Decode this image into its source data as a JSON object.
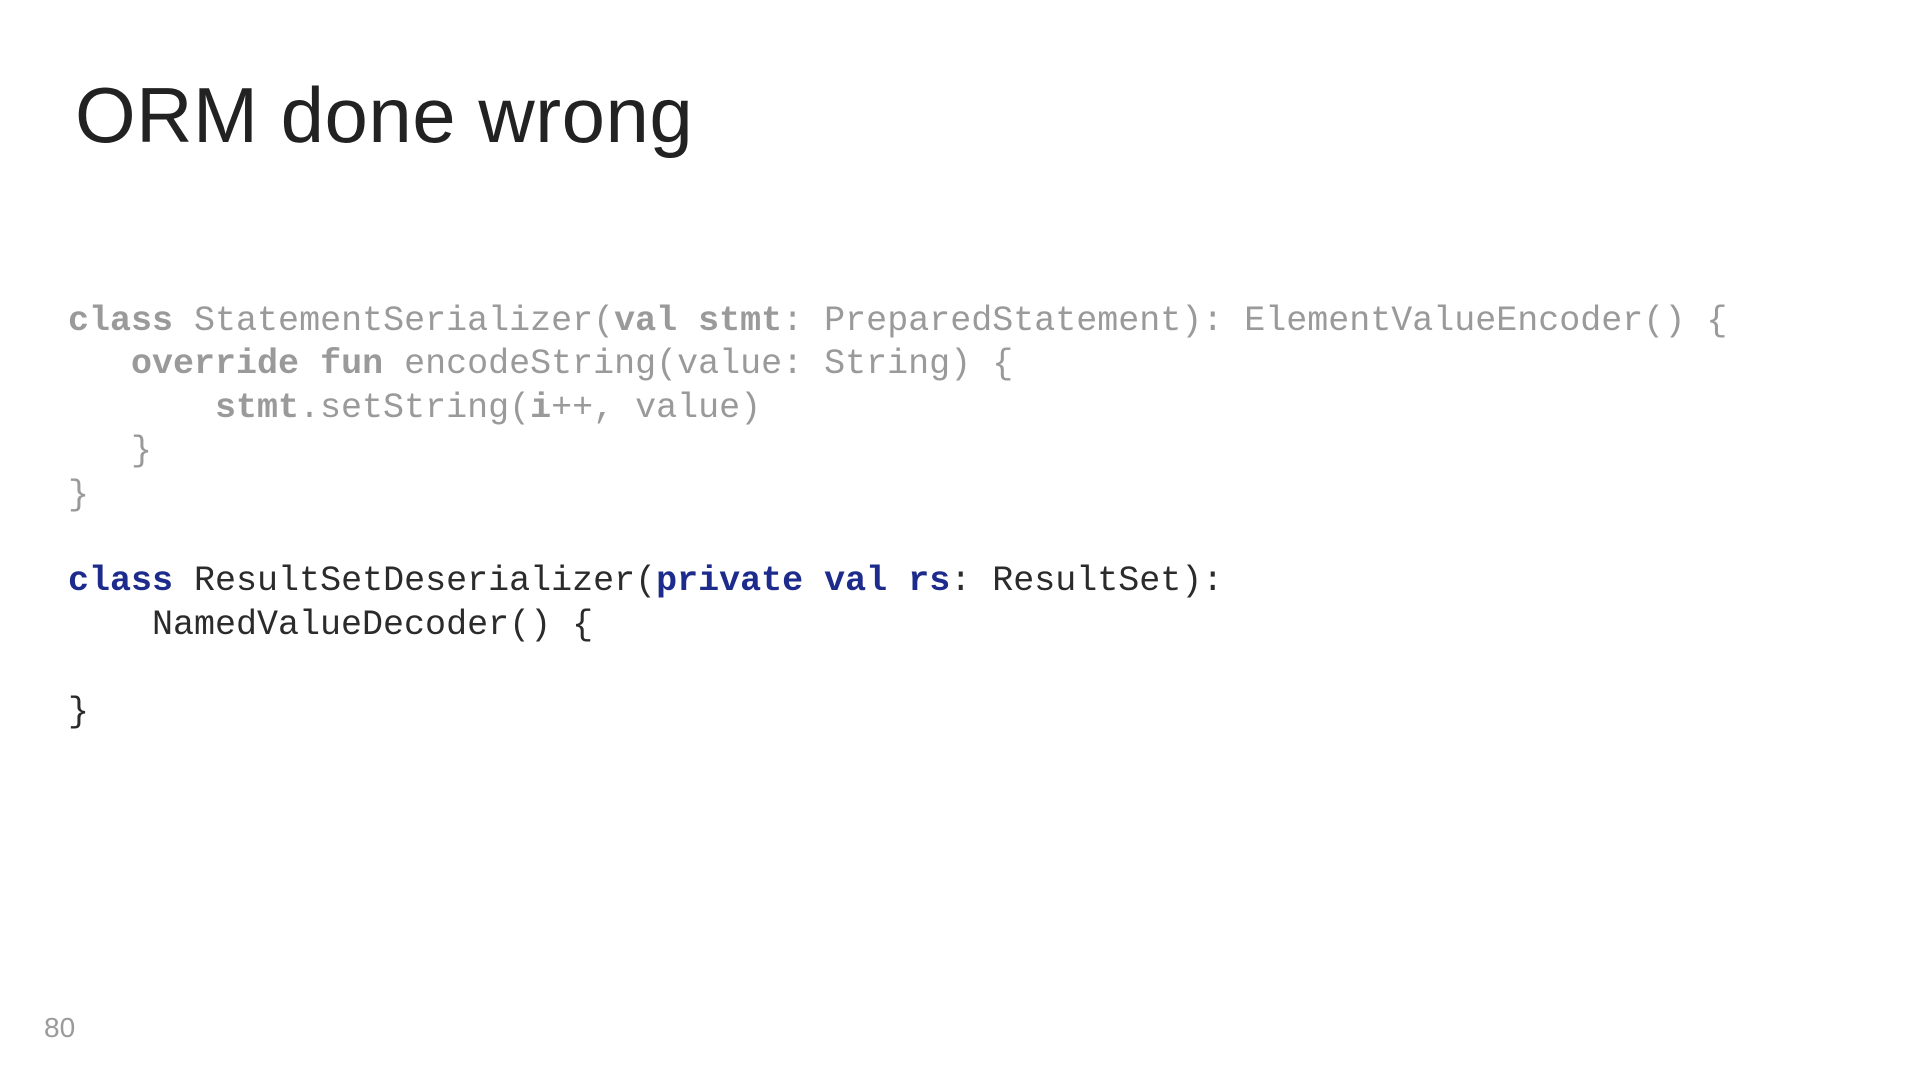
{
  "title": "ORM done wrong",
  "page_number": "80",
  "code": {
    "block1": {
      "kw_class": "class",
      "space1": " ",
      "text1": "StatementSerializer(",
      "kw_val": "val",
      "space2": " ",
      "ident_stmt": "stmt",
      "text2": ": PreparedStatement): ElementValueEncoder() {",
      "line2_indent": "   ",
      "kw_override": "override",
      "space3": " ",
      "kw_fun": "fun",
      "space4": " ",
      "text3": "encodeString(value: String) {",
      "line3_indent": "       ",
      "ident_stmt2": "stmt",
      "text4": ".setString(",
      "ident_i": "i",
      "text5": "++, value)",
      "line4": "   }",
      "line5": "}"
    },
    "block2": {
      "kw_class": "class",
      "space1": " ",
      "text1": "ResultSetDeserializer(",
      "kw_private": "private",
      "space2": " ",
      "kw_val": "val",
      "space3": " ",
      "ident_rs": "rs",
      "text2": ": ResultSet):",
      "line2_indent": "    ",
      "text3": "NamedValueDecoder() {",
      "blank": "",
      "line4": "}"
    }
  }
}
